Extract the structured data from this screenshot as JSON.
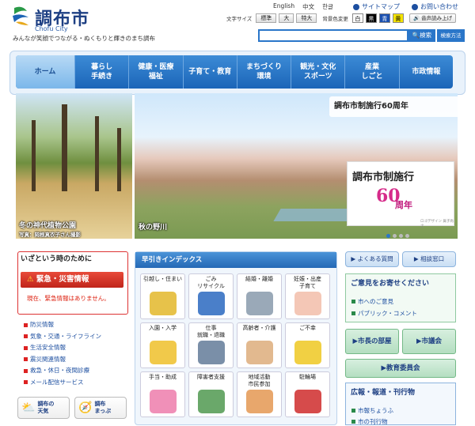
{
  "header": {
    "title": "調布市",
    "subtitle": "Chofu City",
    "slogan": "みんなが笑顔でつながる・ぬくもりと輝きのまち調布",
    "languages": [
      "English",
      "中文",
      "한글"
    ],
    "sitemap": "サイトマップ",
    "contact": "お問い合わせ",
    "font_size_label": "文字サイズ",
    "font_sizes": [
      "標準",
      "大",
      "特大"
    ],
    "bg_color_label": "背景色変更",
    "bg_colors": [
      {
        "label": "白",
        "bg": "#ffffff",
        "fg": "#000000"
      },
      {
        "label": "黒",
        "bg": "#000000",
        "fg": "#ffffff"
      },
      {
        "label": "青",
        "bg": "#1a50b0",
        "fg": "#ffffff"
      },
      {
        "label": "黄",
        "bg": "#f4e300",
        "fg": "#000000"
      }
    ],
    "voice": "音声読み上げ",
    "search_placeholder": "",
    "search_button": "検索",
    "search_method": "検索方法"
  },
  "nav": [
    {
      "label": "ホーム",
      "active": true
    },
    {
      "label": "暮らし\n手続き"
    },
    {
      "label": "健康・医療\n福祉"
    },
    {
      "label": "子育て・教育"
    },
    {
      "label": "まちづくり\n環境"
    },
    {
      "label": "観光・文化\nスポーツ"
    },
    {
      "label": "産業\nしごと"
    },
    {
      "label": "市政情報"
    }
  ],
  "hero": {
    "caption1": "冬の神代植物公園",
    "credit1": "写真：岡根真衣子さん撮影",
    "caption2": "秋の野川",
    "anniv_banner": "調布市制施行60周年",
    "anniv_title": "調布市制施行",
    "anniv_num": "60",
    "anniv_year": "周年",
    "anniv_credit": "ロゴデザイン 眞子尚之"
  },
  "emergency": {
    "title": "いざという時のために",
    "head": "緊急・災害情報",
    "text": "現在、緊急情報はありません。",
    "links": [
      "防災情報",
      "気象・交通・ライフライン",
      "生活安全情報",
      "震災関連情報",
      "救急・休日・夜間診療",
      "メール配信サービス"
    ],
    "weather": "調布の\n天気",
    "map": "調布\nまっぷ"
  },
  "index": {
    "title": "早引きインデックス",
    "cells": [
      {
        "label": "引越し・住まい",
        "color": "#e7c24a"
      },
      {
        "label": "ごみ\nリサイクル",
        "color": "#4a7fc9"
      },
      {
        "label": "結婚・離婚",
        "color": "#9aa9b8"
      },
      {
        "label": "妊娠・出産\n子育て",
        "color": "#f4c7b6"
      },
      {
        "label": "入園・入学",
        "color": "#f1c94a"
      },
      {
        "label": "仕事\n就職・退職",
        "color": "#7a8fa8"
      },
      {
        "label": "高齢者・介護",
        "color": "#e2b98f"
      },
      {
        "label": "ご不幸",
        "color": "#f1d043"
      },
      {
        "label": "手当・助成",
        "color": "#f090b8"
      },
      {
        "label": "障害者支援",
        "color": "#6aa86a"
      },
      {
        "label": "地域活動\n市民参加",
        "color": "#e8a76c"
      },
      {
        "label": "駐輪場",
        "color": "#d64b4b"
      }
    ]
  },
  "right": {
    "faq": "よくある質問",
    "consult": "相談窓口",
    "opinion_title": "ご意見をお寄せください",
    "opinion_links": [
      "市へのご意見",
      "パブリック・コメント"
    ],
    "mayor": "市長の部屋",
    "assembly": "市議会",
    "education": "教育委員会",
    "pr_title": "広報・報道・刊行物",
    "pr_links": [
      "市報ちょうふ",
      "市の刊行物"
    ]
  }
}
